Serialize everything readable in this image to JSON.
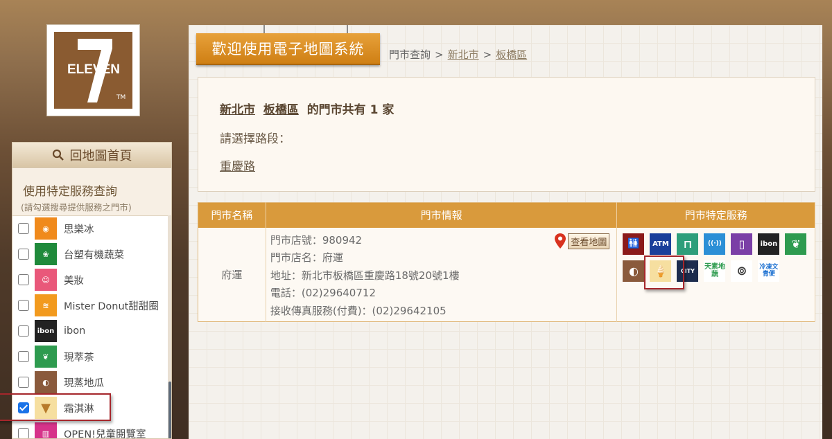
{
  "logo": {
    "text": "ELEVEN",
    "tm": "TM"
  },
  "sidebar": {
    "home_label": "回地圖首頁",
    "service_title": "使用特定服務查詢",
    "service_subtitle": "(請勾選搜尋提供服務之門市)",
    "items": [
      {
        "label": "思樂冰",
        "checked": false,
        "color": "#f08a1c"
      },
      {
        "label": "台塑有機蔬菜",
        "checked": false,
        "color": "#1f8a3b"
      },
      {
        "label": "美妝",
        "checked": false,
        "color": "#e9587a"
      },
      {
        "label": "Mister Donut甜甜圈",
        "checked": false,
        "color": "#f29a1e"
      },
      {
        "label": "ibon",
        "checked": false,
        "color": "#222222"
      },
      {
        "label": "現萃茶",
        "checked": false,
        "color": "#2e9b4f"
      },
      {
        "label": "現蒸地瓜",
        "checked": false,
        "color": "#8a5a3c"
      },
      {
        "label": "霜淇淋",
        "checked": true,
        "color": "#f6dfa0"
      },
      {
        "label": "OPEN!兒童閱覽室",
        "checked": false,
        "color": "#d6338a"
      }
    ]
  },
  "header": {
    "welcome": "歡迎使用電子地圖系統",
    "breadcrumb": {
      "root": "門市查詢",
      "sep": ">",
      "city": "新北市",
      "district": "板橋區"
    }
  },
  "summary": {
    "city": "新北市",
    "district": "板橋區",
    "count_text": "的門市共有",
    "count": "1",
    "unit": "家",
    "road_prompt": "請選擇路段：",
    "road": "重慶路"
  },
  "table": {
    "headers": [
      "門市名稱",
      "門市情報",
      "門市特定服務"
    ],
    "store": {
      "name": "府運",
      "lines": [
        "門市店號：980942",
        "門市店名：府運",
        "地址：新北市板橋區重慶路18號20號1樓",
        "電話：(02)29640712",
        "接收傳真服務(付費)：(02)29642105"
      ],
      "map_button": "查看地圖"
    },
    "service_icons": [
      {
        "name": "restroom-icon",
        "text": "🚻",
        "color": "#8b1a1a"
      },
      {
        "name": "atm-icon",
        "text": "ATM",
        "color": "#1a3f9a"
      },
      {
        "name": "seating-icon",
        "text": "⊓",
        "color": "#2e9e7a"
      },
      {
        "name": "wifi-icon",
        "text": "((·))",
        "color": "#2b8fd6"
      },
      {
        "name": "mobile-charge-icon",
        "text": "▯",
        "color": "#7b3fa6"
      },
      {
        "name": "ibon-icon",
        "text": "ibon",
        "color": "#222222"
      },
      {
        "name": "tea-icon",
        "text": "❦",
        "color": "#2e9b4f"
      },
      {
        "name": "sweet-potato-icon",
        "text": "◐",
        "color": "#8a5a3c"
      },
      {
        "name": "soft-serve-icon",
        "text": "🍦",
        "color": "#f6dfa0"
      },
      {
        "name": "city-cafe-icon",
        "text": "CITY",
        "color": "#1d2c4d"
      },
      {
        "name": "organic-veg-icon",
        "text": "天素地蔬",
        "color": "#ffffff"
      },
      {
        "name": "bakery-icon",
        "text": "⊚",
        "color": "#ffffff"
      },
      {
        "name": "frozen-food-icon",
        "text": "冷凍文青便",
        "color": "#ffffff"
      }
    ]
  }
}
